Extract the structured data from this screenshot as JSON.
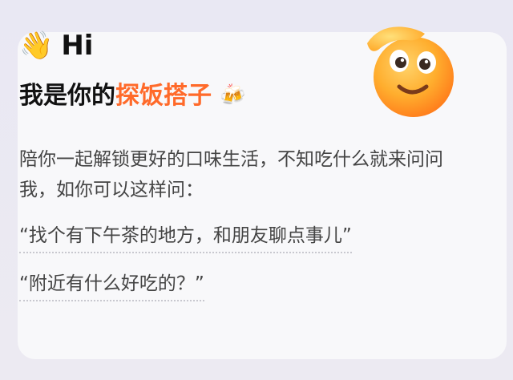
{
  "greeting": {
    "icon": "waving-hand-icon",
    "text": "Hi"
  },
  "title": {
    "prefix": "我是你的",
    "highlight": "探饭搭子",
    "icon": "clinking-drinks-icon",
    "accent_color": "#ff6a2a"
  },
  "intro": "陪你一起解锁更好的口味生活，不知吃什么就来问问我，如你可以这样问：",
  "examples": [
    "“找个有下午茶的地方，和朋友聊点事儿”",
    "“附近有什么好吃的？”"
  ],
  "mascot": {
    "icon": "smiling-face-salute-icon"
  }
}
